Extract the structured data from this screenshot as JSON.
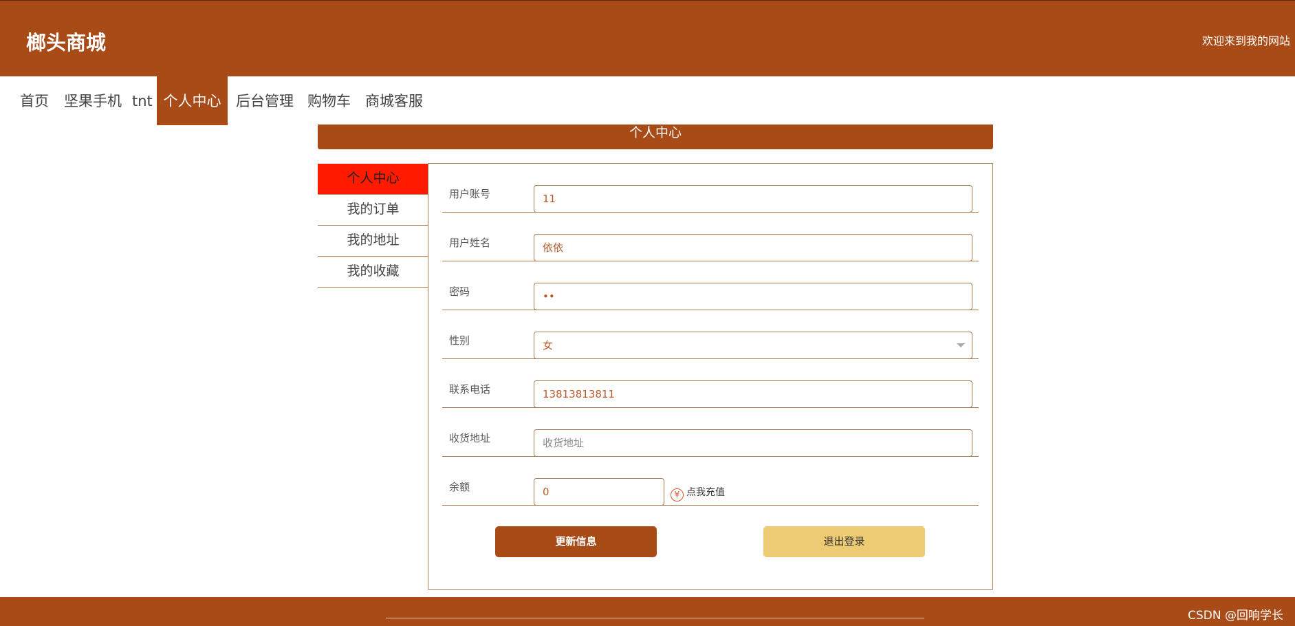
{
  "header": {
    "brand": "榔头商城",
    "welcome": "欢迎来到我的网站"
  },
  "nav": {
    "items": [
      {
        "label": "首页"
      },
      {
        "label": "坚果手机"
      },
      {
        "label": "tnt"
      },
      {
        "label": "个人中心"
      },
      {
        "label": "后台管理"
      },
      {
        "label": "购物车"
      },
      {
        "label": "商城客服"
      }
    ],
    "active": "个人中心"
  },
  "panel": {
    "title": "个人中心"
  },
  "sidebar": {
    "items": [
      {
        "label": "个人中心"
      },
      {
        "label": "我的订单"
      },
      {
        "label": "我的地址"
      },
      {
        "label": "我的收藏"
      }
    ],
    "active": "个人中心"
  },
  "form": {
    "account": {
      "label": "用户账号",
      "value": "11"
    },
    "name": {
      "label": "用户姓名",
      "value": "依依"
    },
    "password": {
      "label": "密码",
      "value": "••"
    },
    "gender": {
      "label": "性别",
      "value": "女"
    },
    "phone": {
      "label": "联系电话",
      "value": "13813813811"
    },
    "address": {
      "label": "收货地址",
      "placeholder": "收货地址"
    },
    "balance": {
      "label": "余额",
      "value": "0"
    },
    "recharge": {
      "label": "点我充值",
      "icon": "yen-icon"
    }
  },
  "buttons": {
    "update": "更新信息",
    "logout": "退出登录"
  },
  "watermark": "CSDN @回响学长",
  "colors": {
    "brand": "#a84b17",
    "active_sidebar": "#ff1a00",
    "logout_button": "#eccb73"
  }
}
